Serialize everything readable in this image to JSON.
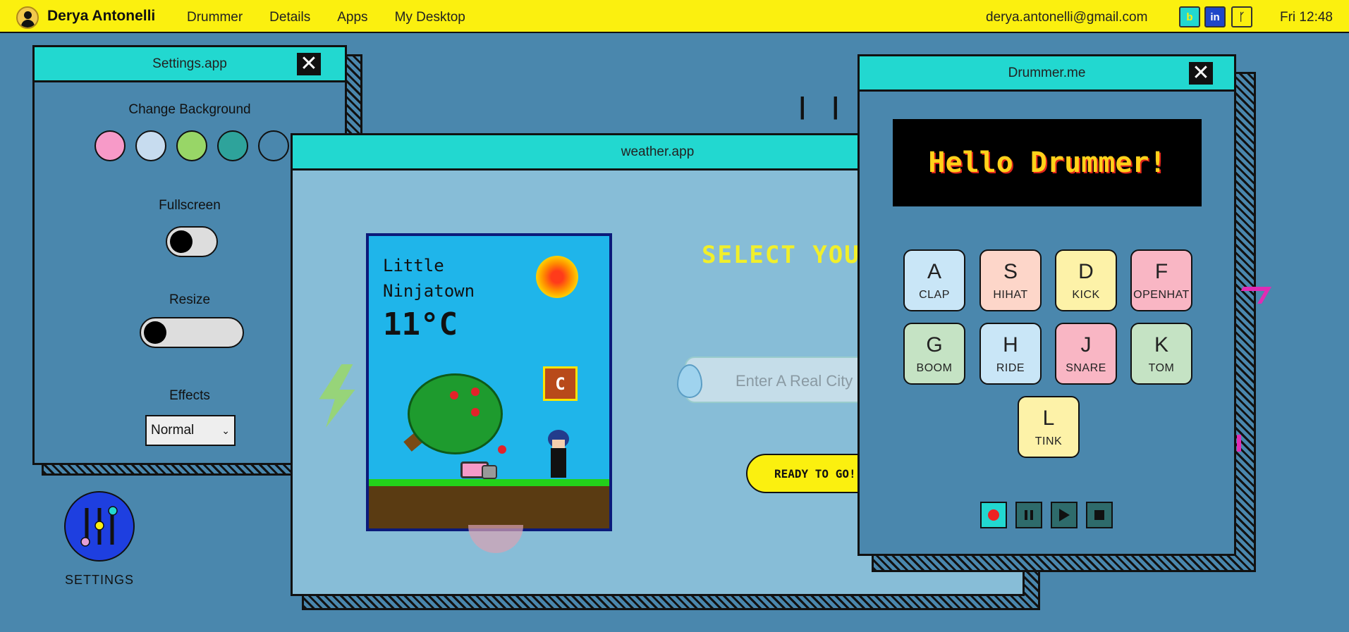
{
  "topbar": {
    "username": "Derya Antonelli",
    "menu": [
      "Drummer",
      "Details",
      "Apps",
      "My Desktop"
    ],
    "email": "derya.antonelli@gmail.com",
    "social": [
      "b",
      "in",
      "ᚴ"
    ],
    "social_icons": [
      "social-b-icon",
      "linkedin-icon",
      "git-fork-icon"
    ],
    "clock": "Fri 12:48",
    "color": "#fbf00f"
  },
  "settings": {
    "title": "Settings.app",
    "change_background": "Change Background",
    "swatches": [
      "#f79ac8",
      "#c7dcef",
      "#98d667",
      "#2ea39b",
      "#4a87ad"
    ],
    "fullscreen": "Fullscreen",
    "resize": "Resize",
    "effects": "Effects",
    "effects_value": "Normal",
    "close": "✕"
  },
  "desktop": {
    "settings_label": "SETTINGS"
  },
  "weather": {
    "title": "weather.app",
    "city_line1": "Little",
    "city_line2": "Ninjatown",
    "temp": "11°C",
    "unit_box": "C",
    "select_title": "SELECT YOUR",
    "input_placeholder": "Enter A Real City N",
    "go_button": "READY TO GO!"
  },
  "drummer": {
    "title": "Drummer.me",
    "display": "Hello Drummer!",
    "close": "✕",
    "pads": [
      {
        "key": "A",
        "sound": "CLAP",
        "color": "#c9e6f7"
      },
      {
        "key": "S",
        "sound": "HIHAT",
        "color": "#fdd6c9"
      },
      {
        "key": "D",
        "sound": "KICK",
        "color": "#fdf2a8"
      },
      {
        "key": "F",
        "sound": "OPENHAT",
        "color": "#f9b6c4"
      },
      {
        "key": "G",
        "sound": "BOOM",
        "color": "#c5e3c4"
      },
      {
        "key": "H",
        "sound": "RIDE",
        "color": "#c9e6f7"
      },
      {
        "key": "J",
        "sound": "SNARE",
        "color": "#f9b6c4"
      },
      {
        "key": "K",
        "sound": "TOM",
        "color": "#c5e3c4"
      },
      {
        "key": "L",
        "sound": "TINK",
        "color": "#fdf2a8"
      }
    ]
  },
  "decor": {
    "ticks": "| | |"
  }
}
